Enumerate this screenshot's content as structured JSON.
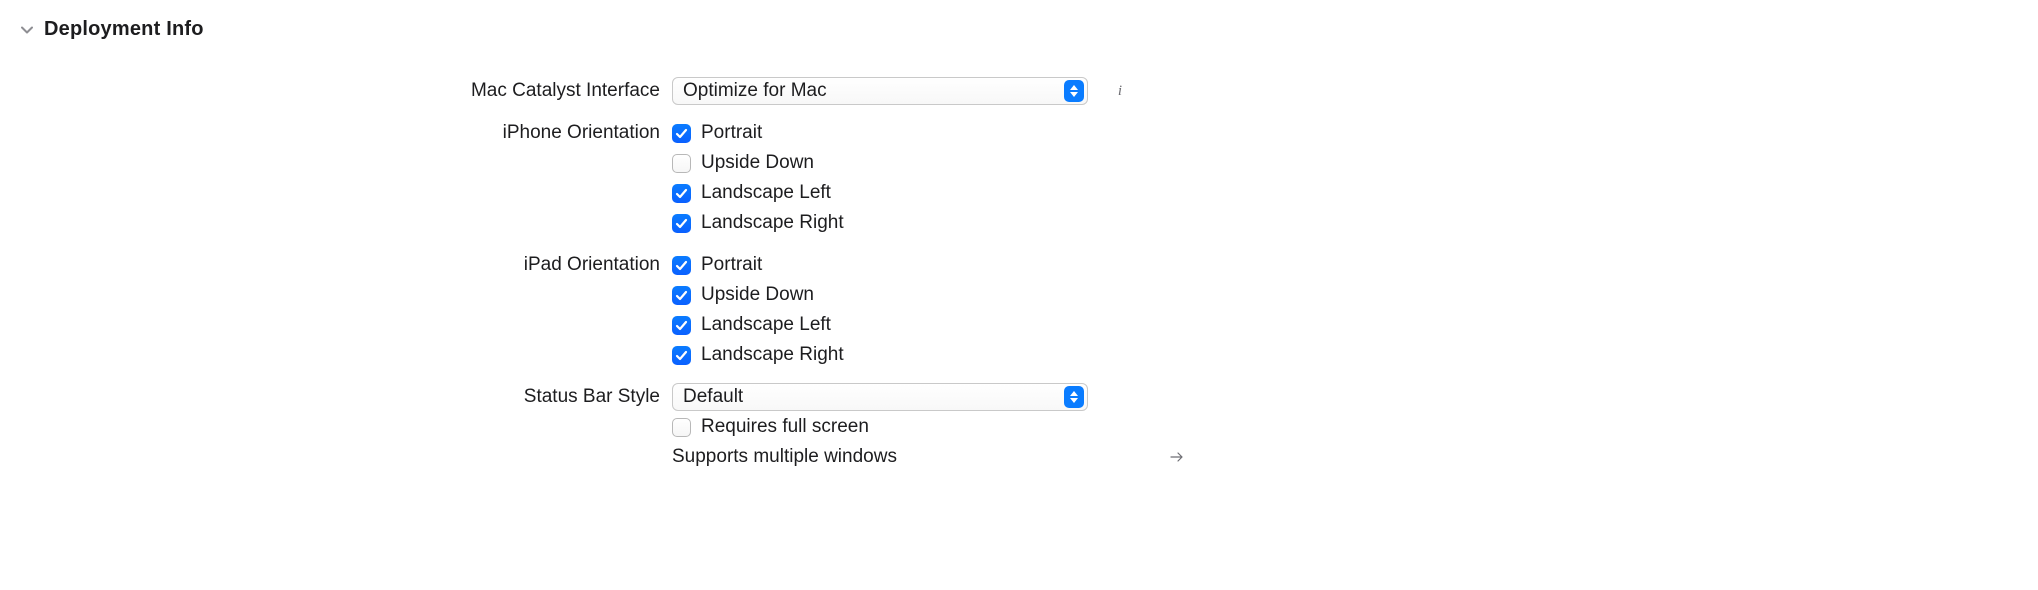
{
  "section": {
    "title": "Deployment Info"
  },
  "macCatalyst": {
    "label": "Mac Catalyst Interface",
    "value": "Optimize for Mac"
  },
  "iphoneOrientation": {
    "label": "iPhone Orientation",
    "options": {
      "portrait": {
        "label": "Portrait",
        "checked": true
      },
      "upsideDown": {
        "label": "Upside Down",
        "checked": false
      },
      "landscapeLeft": {
        "label": "Landscape Left",
        "checked": true
      },
      "landscapeRight": {
        "label": "Landscape Right",
        "checked": true
      }
    }
  },
  "ipadOrientation": {
    "label": "iPad Orientation",
    "options": {
      "portrait": {
        "label": "Portrait",
        "checked": true
      },
      "upsideDown": {
        "label": "Upside Down",
        "checked": true
      },
      "landscapeLeft": {
        "label": "Landscape Left",
        "checked": true
      },
      "landscapeRight": {
        "label": "Landscape Right",
        "checked": true
      }
    }
  },
  "statusBar": {
    "label": "Status Bar Style",
    "value": "Default",
    "requiresFullScreen": {
      "label": "Requires full screen",
      "checked": false
    },
    "multiWindows": {
      "label": "Supports multiple windows"
    }
  }
}
